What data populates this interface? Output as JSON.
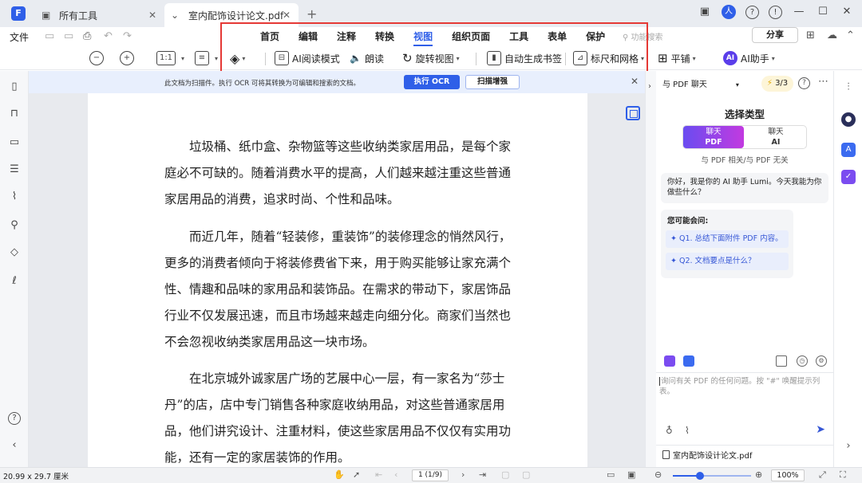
{
  "titlebar": {
    "logo": "F",
    "tabs": [
      {
        "label": "所有工具",
        "icon": "toolbox-icon"
      },
      {
        "label": "室内配饰设计论文.pdf",
        "icon": "pdf-tab-icon"
      }
    ],
    "new_tab": "+",
    "controls": {
      "avatar": "人",
      "help": "?",
      "minimize": "—",
      "maximize": "☐",
      "close": "✕"
    }
  },
  "menu": {
    "file": "文件",
    "nav": [
      "首页",
      "编辑",
      "注释",
      "转换",
      "视图",
      "组织页面",
      "工具",
      "表单",
      "保护"
    ],
    "active_nav": "视图",
    "search_placeholder": "功能搜索",
    "share": "分享"
  },
  "toolbar": {
    "zoom_ratio": "1:1",
    "ai_read": "AI阅读模式",
    "read_aloud": "朗读",
    "rotate": "旋转视图",
    "bookmark": "自动生成书签",
    "rulers": "标尺和网格",
    "tile": "平铺",
    "ai_assistant": "AI助手",
    "ai_badge": "AI"
  },
  "ocr_banner": {
    "text": "此文档为扫描件。执行 OCR 可将其转换为可编辑和搜索的文档。",
    "ocr_button": "执行 OCR",
    "scan_button": "扫描增强"
  },
  "document": {
    "paragraphs": [
      "垃圾桶、纸巾盒、杂物篮等这些收纳类家居用品，是每个家庭必不可缺的。随着消费水平的提高，人们越来越注重这些普通家居用品的消费，追求时尚、个性和品味。",
      "而近几年，随着“轻装修，重装饰”的装修理念的悄然风行，更多的消费者倾向于将装修费省下来，用于购买能够让家充满个性、情趣和品味的家用品和装饰品。在需求的带动下，家居饰品行业不仅发展迅速，而且市场越来越走向细分化。商家们当然也不会忽视收纳类家居用品这一块市场。",
      "在北京城外诚家居广场的艺展中心一层，有一家名为“莎士丹”的店，店中专门销售各种家庭收纳用品，对这些普通家居用品，他们讲究设计、注重材料，使这些家居用品不仅仅有实用功能，还有一定的家居装饰的作用。"
    ]
  },
  "chat": {
    "mode_select": "与 PDF 聊天",
    "count": "3/3",
    "select_title": "选择类型",
    "option_a_top": "聊天",
    "option_a_bottom": "PDF",
    "option_b_top": "聊天",
    "option_b_bottom": "AI",
    "option_caption": "与 PDF 相关/与 PDF 无关",
    "greeting": "你好，我是你的 AI 助手 Lumi。今天我能为你做些什么？",
    "suggest_title": "您可能会问:",
    "questions": [
      "Q1. 总结下面附件 PDF 内容。",
      "Q2. 文档要点是什么？"
    ],
    "input_placeholder": "询问有关 PDF 的任何问题。按 \"#\" 唤醒提示列表。",
    "attached_file": "室内配饰设计论文.pdf"
  },
  "status": {
    "page_size": "20.99 x 29.7 厘米",
    "page_indicator": "1 (1/9)",
    "zoom": "100%",
    "zoom_fraction": 0.35
  },
  "colors": {
    "accent": "#2f5fe8",
    "highlight_frame": "#e53935",
    "ai_gradient_start": "#6a4cf0",
    "ai_gradient_end": "#c23ae0"
  }
}
